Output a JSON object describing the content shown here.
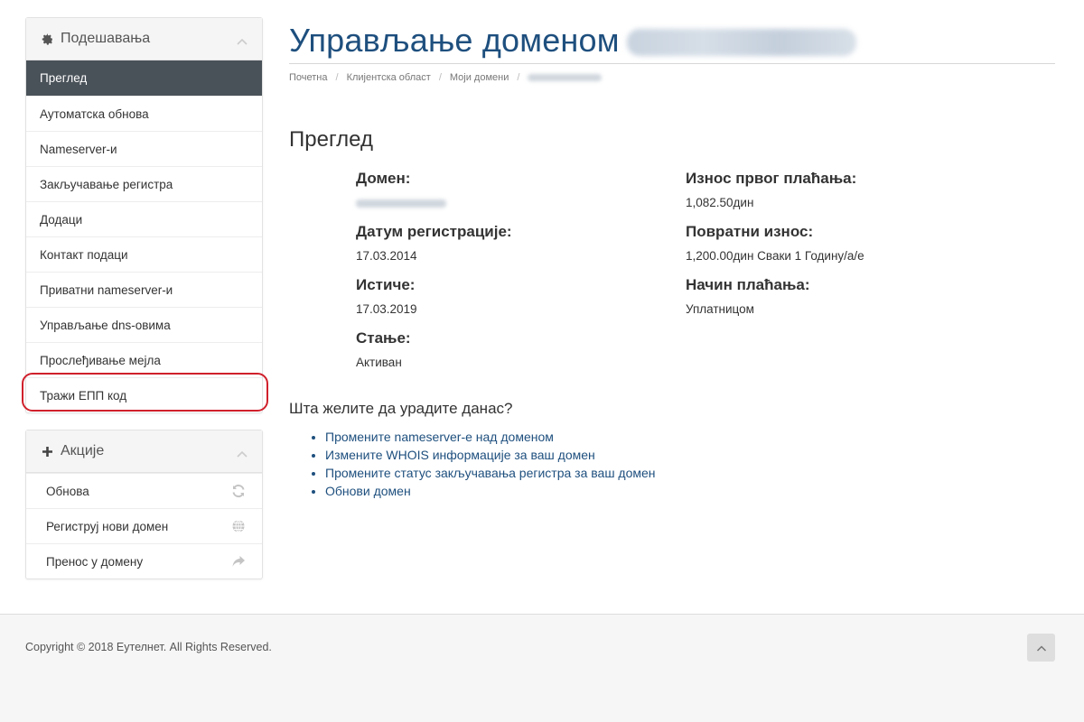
{
  "sidebar": {
    "settings": {
      "title": "Подешавања",
      "items": [
        {
          "label": "Преглед",
          "active": true
        },
        {
          "label": "Аутоматска обнова"
        },
        {
          "label": "Nameserver-и"
        },
        {
          "label": "Закључавање регистра"
        },
        {
          "label": "Додаци"
        },
        {
          "label": "Контакт подаци"
        },
        {
          "label": "Приватни nameserver-и"
        },
        {
          "label": "Управљање dns-овима"
        },
        {
          "label": "Прослеђивање мејла"
        },
        {
          "label": "Тражи ЕПП код"
        }
      ]
    },
    "actions": {
      "title": "Акције",
      "items": [
        {
          "label": "Обнова",
          "icon": "refresh-icon"
        },
        {
          "label": "Региструј нови домен",
          "icon": "globe-icon"
        },
        {
          "label": "Пренос у домену",
          "icon": "share-arrow-icon"
        }
      ]
    }
  },
  "header": {
    "title": "Управљање доменом"
  },
  "breadcrumb": [
    "Почетна",
    "Клијентска област",
    "Моји домени"
  ],
  "overview": {
    "title": "Преглед",
    "left": [
      {
        "label": "Домен:",
        "value": ""
      },
      {
        "label": "Датум регистрације:",
        "value": "17.03.2014"
      },
      {
        "label": "Истиче:",
        "value": "17.03.2019"
      },
      {
        "label": "Стање:",
        "value": "Активан"
      }
    ],
    "right": [
      {
        "label": "Износ првог плаћања:",
        "value": "1,082.50дин"
      },
      {
        "label": "Повратни износ:",
        "value": "1,200.00дин Сваки 1 Годину/а/е"
      },
      {
        "label": "Начин плаћања:",
        "value": "Уплатницом"
      }
    ]
  },
  "question": "Шта желите да урадите данас?",
  "links": [
    "Промените nameserver-е над доменом",
    "Измените WHOIS информације за ваш домен",
    "Промените статус закључавања регистра за ваш домен",
    "Обнови домен"
  ],
  "footer": {
    "copyright": "Copyright © 2018 Еутелнет. All Rights Reserved."
  },
  "colors": {
    "accent": "#1e4f7e",
    "active_item_bg": "#4a5259",
    "highlight_ring": "#d0202b"
  }
}
